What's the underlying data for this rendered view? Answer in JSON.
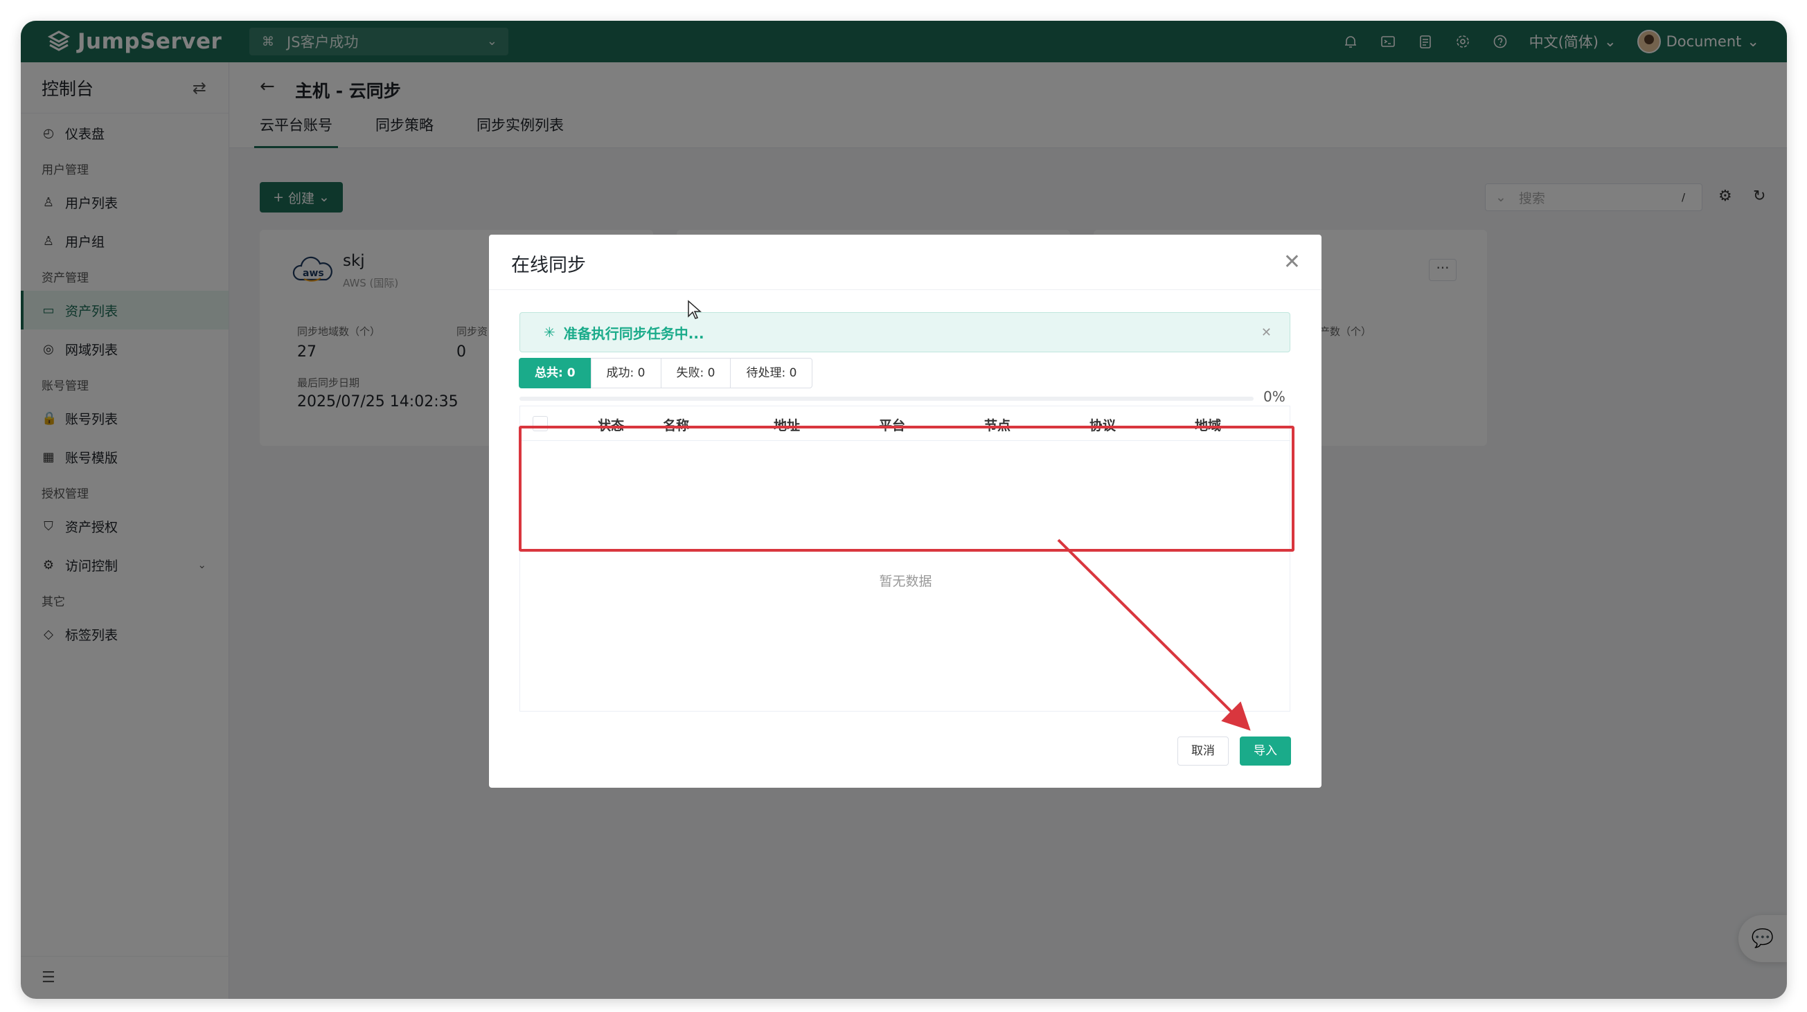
{
  "app": {
    "logo_text": "JumpServer",
    "org": "JS客户成功"
  },
  "topbar": {
    "language": "中文(简体)",
    "user": "Document"
  },
  "sidebar": {
    "title": "控制台",
    "items": [
      {
        "type": "item",
        "label": "仪表盘",
        "icon": "dashboard-icon"
      },
      {
        "type": "group",
        "label": "用户管理"
      },
      {
        "type": "item",
        "label": "用户列表",
        "icon": "user-icon"
      },
      {
        "type": "item",
        "label": "用户组",
        "icon": "user-group-icon"
      },
      {
        "type": "group",
        "label": "资产管理"
      },
      {
        "type": "item",
        "label": "资产列表",
        "icon": "asset-icon",
        "active": true
      },
      {
        "type": "item",
        "label": "网域列表",
        "icon": "domain-icon"
      },
      {
        "type": "group",
        "label": "账号管理"
      },
      {
        "type": "item",
        "label": "账号列表",
        "icon": "lock-icon"
      },
      {
        "type": "item",
        "label": "账号模版",
        "icon": "template-icon"
      },
      {
        "type": "group",
        "label": "授权管理"
      },
      {
        "type": "item",
        "label": "资产授权",
        "icon": "shield-icon"
      },
      {
        "type": "item",
        "label": "访问控制",
        "icon": "access-control-icon",
        "expandable": true
      },
      {
        "type": "group",
        "label": "其它"
      },
      {
        "type": "item",
        "label": "标签列表",
        "icon": "tag-icon"
      }
    ]
  },
  "page": {
    "title": "主机 - 云同步",
    "tabs": [
      "云平台账号",
      "同步策略",
      "同步实例列表"
    ],
    "create_label": "创建",
    "search_placeholder": "搜索",
    "search_shortcut": "/"
  },
  "card": {
    "name": "skj",
    "provider": "AWS (国际)",
    "brand_text": "aws",
    "regions_label": "同步地域数（个）",
    "regions_value": "27",
    "assets_label_partial": "同步资",
    "assets_value": "0",
    "date_label": "最后同步日期",
    "date_value": "2025/07/25 14:02:35",
    "third_label_partial": "产数（个）"
  },
  "modal": {
    "title": "在线同步",
    "alert": "准备执行同步任务中...",
    "stats": [
      {
        "label": "总共: 0",
        "active": true
      },
      {
        "label": "成功: 0"
      },
      {
        "label": "失败: 0"
      },
      {
        "label": "待处理: 0"
      }
    ],
    "progress_percent": 0,
    "progress_text": "0%",
    "columns": [
      "状态",
      "名称",
      "地址",
      "平台",
      "节点",
      "协议",
      "地域"
    ],
    "empty_text": "暂无数据",
    "cancel_label": "取消",
    "import_label": "导入"
  },
  "colors": {
    "brand": "#1c6d56",
    "accent": "#1aab8a",
    "highlight": "#d9363e"
  }
}
